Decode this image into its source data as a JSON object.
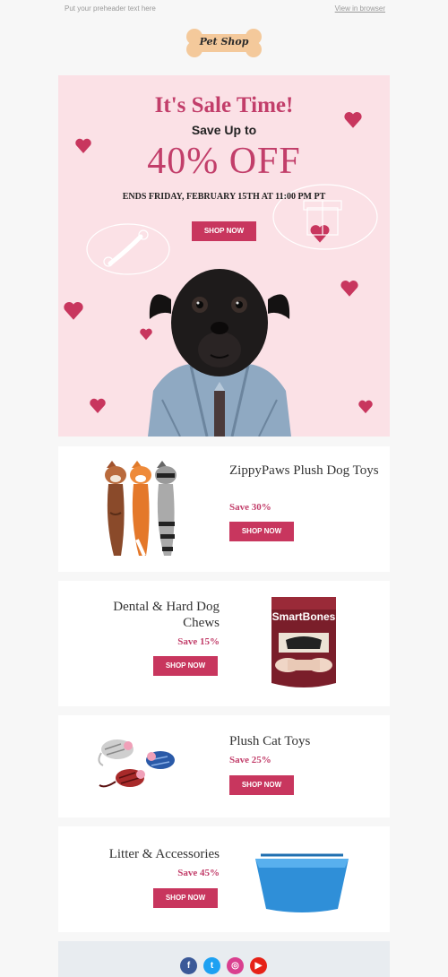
{
  "preheader": {
    "text": "Put your preheader text here",
    "view_link": "View in browser"
  },
  "logo": {
    "text": "Pet Shop"
  },
  "hero": {
    "title": "It's Sale Time!",
    "subtitle": "Save Up to",
    "discount": "40% OFF",
    "ends": "ENDS FRIDAY, FEBRUARY 15TH AT 11:00 PM PT",
    "button": "SHOP NOW"
  },
  "products": [
    {
      "name": "ZippyPaws Plush Dog Toys",
      "save": "Save 30%",
      "button": "SHOP NOW",
      "image": "plush-dog-toys"
    },
    {
      "name": "Dental & Hard Dog Chews",
      "save": "Save 15%",
      "button": "SHOP NOW",
      "image": "smartbones-dog-chews",
      "package_brand": "SmartBones"
    },
    {
      "name": "Plush Cat Toys",
      "save": "Save 25%",
      "button": "SHOP NOW",
      "image": "plush-cat-mice"
    },
    {
      "name": "Litter & Accessories",
      "save": "Save 45%",
      "button": "SHOP NOW",
      "image": "blue-litter-box"
    }
  ],
  "social": [
    {
      "name": "facebook",
      "glyph": "f",
      "color": "#3b5998"
    },
    {
      "name": "twitter",
      "glyph": "t",
      "color": "#1da1f2"
    },
    {
      "name": "instagram",
      "glyph": "◎",
      "color": "#d93f8f"
    },
    {
      "name": "youtube",
      "glyph": "▶",
      "color": "#e62117"
    }
  ],
  "colors": {
    "accent": "#c23e6a",
    "button": "#c8365e",
    "hero_bg": "#fbe1e6",
    "logo_bone": "#f4c99b"
  }
}
